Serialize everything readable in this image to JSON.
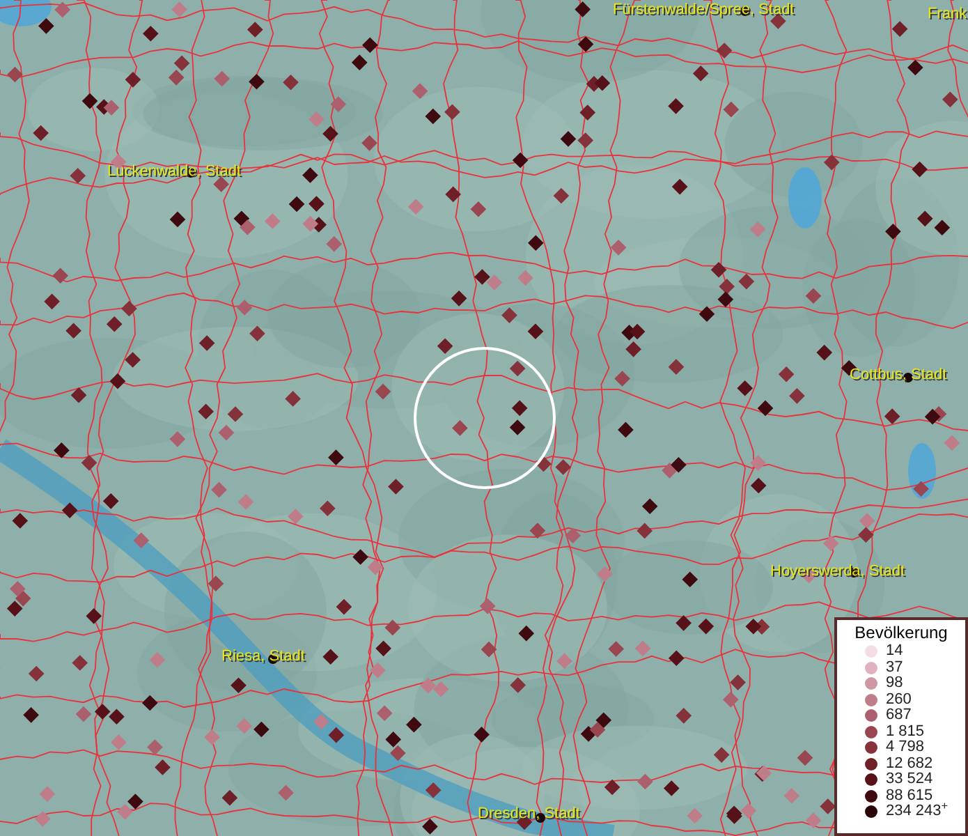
{
  "map": {
    "places": [
      {
        "label": "Fürstenwalde/Spree, Stadt"
      },
      {
        "label": "Frank"
      },
      {
        "label": "Luckenwalde, Stadt"
      },
      {
        "label": "Cottbus, Stadt"
      },
      {
        "label": "Hoyerswerda, Stadt"
      },
      {
        "label": "Riesa, Stadt"
      },
      {
        "label": "Dresden, Stadt"
      }
    ]
  },
  "legend": {
    "title": "Bevölkerung",
    "items": [
      {
        "label": "14",
        "color": "#f5dde6"
      },
      {
        "label": "37",
        "color": "#e0b2bf"
      },
      {
        "label": "98",
        "color": "#cf97a4"
      },
      {
        "label": "260",
        "color": "#bf7d8a"
      },
      {
        "label": "687",
        "color": "#ac5f6c"
      },
      {
        "label": "1 815",
        "color": "#9a4650"
      },
      {
        "label": "4 798",
        "color": "#85323b"
      },
      {
        "label": "12 682",
        "color": "#6e1f27"
      },
      {
        "label": "33 524",
        "color": "#561218"
      },
      {
        "label": "88 615",
        "color": "#3e0a0f"
      },
      {
        "label": "234 243$^{+}$",
        "color": "#280608"
      }
    ]
  }
}
